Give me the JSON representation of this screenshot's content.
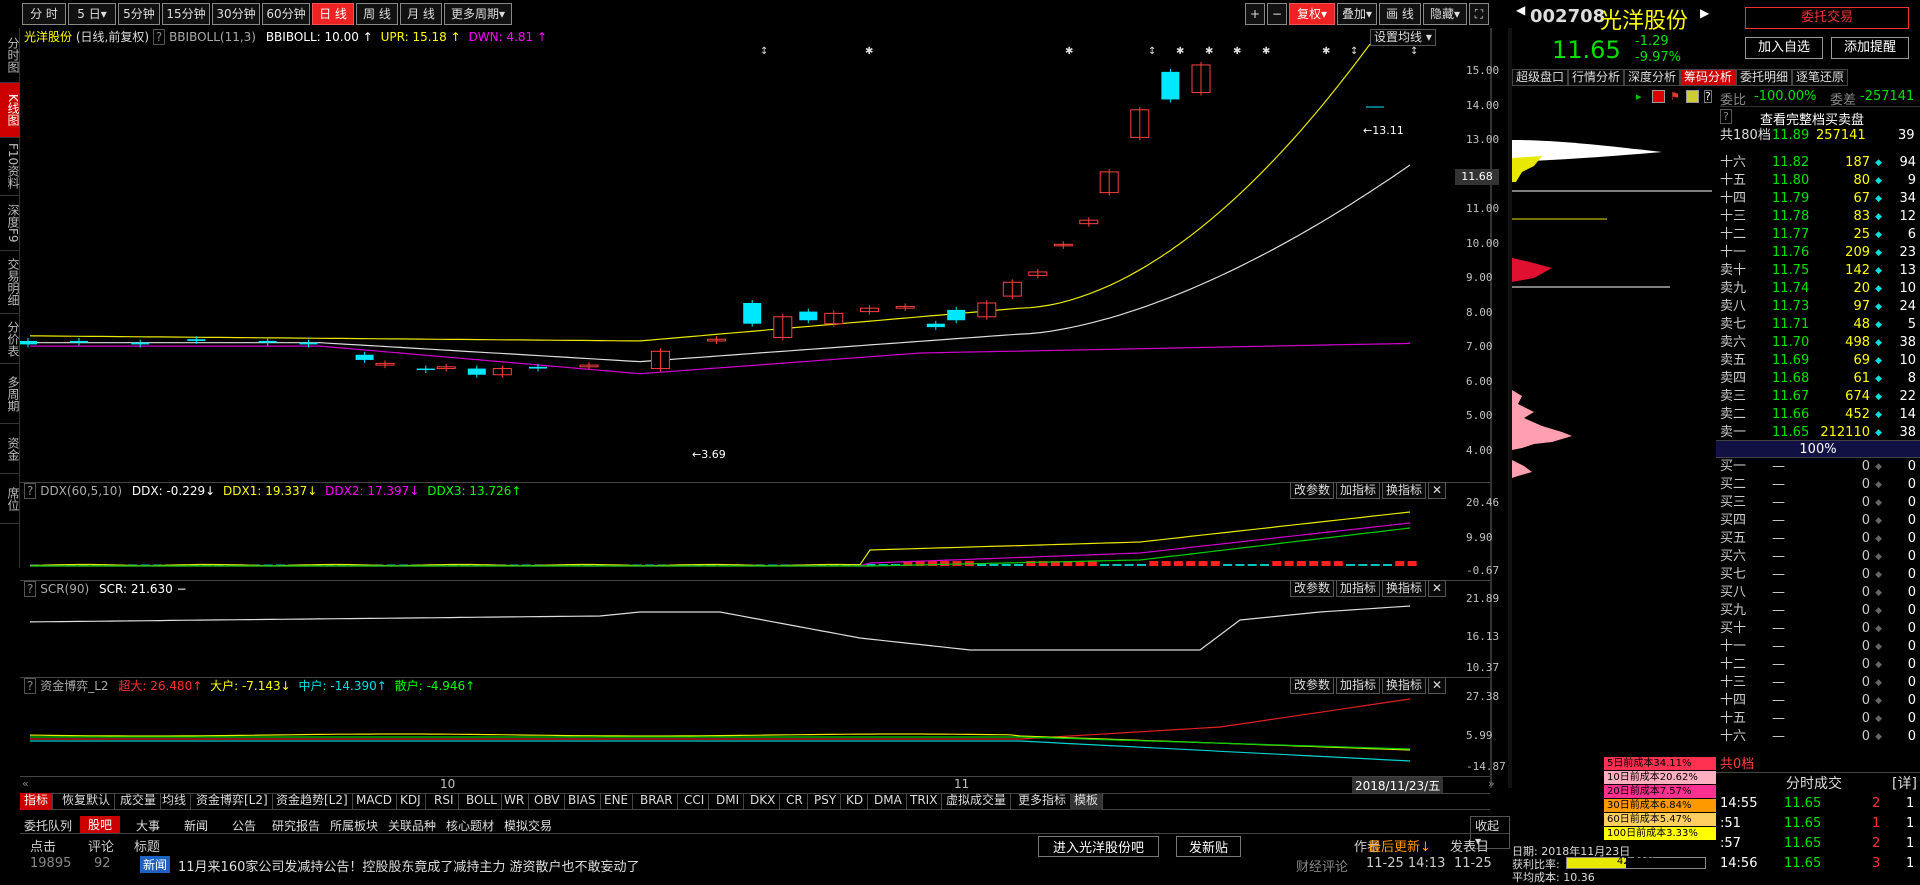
{
  "toolbar": {
    "periods": [
      "分 时",
      "5 日▾",
      "5分钟",
      "15分钟",
      "30分钟",
      "60分钟",
      "日 线",
      "周 线",
      "月 线",
      "更多周期▾"
    ],
    "right_buttons": [
      "+",
      "−",
      "复权▾",
      "叠加▾",
      "画 线",
      "隐藏▾",
      "⛶"
    ]
  },
  "left_tabs": [
    "分时图",
    "K线图",
    "F10资料",
    "深度F9",
    "交易明细",
    "分价表",
    "多周期",
    "资金",
    "席位"
  ],
  "kline": {
    "header_name": "光洋股份",
    "header_mode": "(日线,前复权)",
    "indicator": "BBIBOLL(11,3)",
    "bbiboll": "BBIBOLL: 10.00",
    "upr": "UPR: 15.18",
    "dwn": "DWN: 4.81",
    "settings": "设置均线",
    "y_ticks": [
      "15.00",
      "14.00",
      "13.00",
      "12.00",
      "11.00",
      "10.00",
      "9.00",
      "8.00",
      "7.00",
      "6.00",
      "5.00",
      "4.00"
    ],
    "price_tag": "11.68",
    "high_label": "13.11",
    "low_label": "3.69"
  },
  "ddx": {
    "title": "DDX(60,5,10)",
    "ddx": "DDX: -0.229",
    "ddx1": "DDX1: 19.337",
    "ddx2": "DDX2: 17.397",
    "ddx3": "DDX3: 13.726",
    "ticks": [
      "20.46",
      "9.90",
      "-0.67"
    ]
  },
  "scr": {
    "title": "SCR(90)",
    "value": "SCR: 21.630",
    "ticks": [
      "21.89",
      "16.13",
      "10.37"
    ]
  },
  "fund": {
    "title": "资金博弈_L2",
    "super": "超大: 26.480",
    "big": "大户: -7.143",
    "mid": "中户: -14.390",
    "small": "散户: -4.946",
    "ticks": [
      "27.38",
      "5.99",
      "-14.87"
    ]
  },
  "panel_buttons": [
    "改参数",
    "加指标",
    "换指标"
  ],
  "xaxis": {
    "labels": [
      "10",
      "11"
    ],
    "date": "2018/11/23/五"
  },
  "bottom_tabs": [
    "指标",
    "恢复默认",
    "成交量",
    "均线",
    "资金博弈[L2]",
    "资金趋势[L2]",
    "MACD",
    "KDJ",
    "RSI",
    "BOLL",
    "WR",
    "OBV",
    "BIAS",
    "ENE",
    "BRAR",
    "CCI",
    "DMI",
    "DKX",
    "CR",
    "PSY",
    "KD",
    "DMA",
    "TRIX",
    "虚拟成交量",
    "更多指标",
    "模板"
  ],
  "news_tabs": [
    "委托队列",
    "股吧",
    "大事",
    "新闻",
    "公告",
    "研究报告",
    "所属板块",
    "关联品种",
    "核心题材",
    "模拟交易"
  ],
  "news_collapse": "收起",
  "news_header": {
    "clicks": "点击",
    "comments": "评论",
    "title": "标题",
    "enter": "进入光洋股份吧",
    "post": "发新贴",
    "author": "作者",
    "latest": "最后更新↓",
    "posted": "发表日"
  },
  "news_rows": [
    {
      "clicks": "19895",
      "comments": "92",
      "tag": "新闻",
      "title": "11月来160家公司发减持公告！控股股东竟成了减持主力 游资散户也不敢妄动了",
      "author": "财经评论",
      "latest": "11-25 14:13",
      "posted": "11-25"
    }
  ],
  "quote": {
    "code": "002708",
    "name": "光洋股份",
    "price": "11.65",
    "change": "-1.29",
    "pct": "-9.97%",
    "btn_trade": "委托交易",
    "btn_fav": "加入自选",
    "btn_alert": "添加提醒",
    "tabs": [
      "超级盘口",
      "行情分析",
      "深度分析",
      "筹码分析",
      "委托明细",
      "逐笔还原"
    ],
    "weibi_label": "委比",
    "weibi": "-100.00%",
    "weicha_label": "委差",
    "weicha": "-257141",
    "full_book": "查看完整档买卖盘",
    "total_levels": "共180档",
    "total_price": "11.89",
    "total_vol": "257141",
    "total_cnt": "39",
    "asks": [
      {
        "lvl": "十六",
        "price": "11.82",
        "vol": "187",
        "cnt": "94"
      },
      {
        "lvl": "十五",
        "price": "11.80",
        "vol": "80",
        "cnt": "9"
      },
      {
        "lvl": "十四",
        "price": "11.79",
        "vol": "67",
        "cnt": "34"
      },
      {
        "lvl": "十三",
        "price": "11.78",
        "vol": "83",
        "cnt": "12"
      },
      {
        "lvl": "十二",
        "price": "11.77",
        "vol": "25",
        "cnt": "6"
      },
      {
        "lvl": "十一",
        "price": "11.76",
        "vol": "209",
        "cnt": "23"
      },
      {
        "lvl": "卖十",
        "price": "11.75",
        "vol": "142",
        "cnt": "13"
      },
      {
        "lvl": "卖九",
        "price": "11.74",
        "vol": "20",
        "cnt": "10"
      },
      {
        "lvl": "卖八",
        "price": "11.73",
        "vol": "97",
        "cnt": "24"
      },
      {
        "lvl": "卖七",
        "price": "11.71",
        "vol": "48",
        "cnt": "5"
      },
      {
        "lvl": "卖六",
        "price": "11.70",
        "vol": "498",
        "cnt": "38"
      },
      {
        "lvl": "卖五",
        "price": "11.69",
        "vol": "69",
        "cnt": "10"
      },
      {
        "lvl": "卖四",
        "price": "11.68",
        "vol": "61",
        "cnt": "8"
      },
      {
        "lvl": "卖三",
        "price": "11.67",
        "vol": "674",
        "cnt": "22"
      },
      {
        "lvl": "卖二",
        "price": "11.66",
        "vol": "452",
        "cnt": "14"
      },
      {
        "lvl": "卖一",
        "price": "11.65",
        "vol": "212110",
        "cnt": "38"
      }
    ],
    "pct_bar": "100%",
    "bids": [
      {
        "lvl": "买一",
        "price": "—",
        "vol": "0",
        "cnt": "0"
      },
      {
        "lvl": "买二",
        "price": "—",
        "vol": "0",
        "cnt": "0"
      },
      {
        "lvl": "买三",
        "price": "—",
        "vol": "0",
        "cnt": "0"
      },
      {
        "lvl": "买四",
        "price": "—",
        "vol": "0",
        "cnt": "0"
      },
      {
        "lvl": "买五",
        "price": "—",
        "vol": "0",
        "cnt": "0"
      },
      {
        "lvl": "买六",
        "price": "—",
        "vol": "0",
        "cnt": "0"
      },
      {
        "lvl": "买七",
        "price": "—",
        "vol": "0",
        "cnt": "0"
      },
      {
        "lvl": "买八",
        "price": "—",
        "vol": "0",
        "cnt": "0"
      },
      {
        "lvl": "买九",
        "price": "—",
        "vol": "0",
        "cnt": "0"
      },
      {
        "lvl": "买十",
        "price": "—",
        "vol": "0",
        "cnt": "0"
      },
      {
        "lvl": "十一",
        "price": "—",
        "vol": "0",
        "cnt": "0"
      },
      {
        "lvl": "十二",
        "price": "—",
        "vol": "0",
        "cnt": "0"
      },
      {
        "lvl": "十三",
        "price": "—",
        "vol": "0",
        "cnt": "0"
      },
      {
        "lvl": "十四",
        "price": "—",
        "vol": "0",
        "cnt": "0"
      },
      {
        "lvl": "十五",
        "price": "—",
        "vol": "0",
        "cnt": "0"
      },
      {
        "lvl": "十六",
        "price": "—",
        "vol": "0",
        "cnt": "0"
      }
    ],
    "bid_total": "共0档",
    "ticks_title": "分时成交",
    "ticks_detail": "[详]",
    "ticks": [
      {
        "time": "14:55",
        "price": "11.65",
        "vol": "2",
        "n": "1"
      },
      {
        "time": ":51",
        "price": "11.65",
        "vol": "1",
        "n": "1"
      },
      {
        "time": ":57",
        "price": "11.65",
        "vol": "2",
        "n": "1"
      },
      {
        "time": "14:56",
        "price": "11.65",
        "vol": "3",
        "n": "1"
      }
    ]
  },
  "chips": {
    "legend": [
      "5日前成本34.11%",
      "10日前成本20.62%",
      "20日前成本7.57%",
      "30日前成本6.84%",
      "60日前成本5.47%",
      "100日前成本3.33%"
    ],
    "date": "日期: 2018年11月23日",
    "profit_label": "获利比率:",
    "profit": "42.51%",
    "avg_cost": "平均成本: 10.36"
  }
}
